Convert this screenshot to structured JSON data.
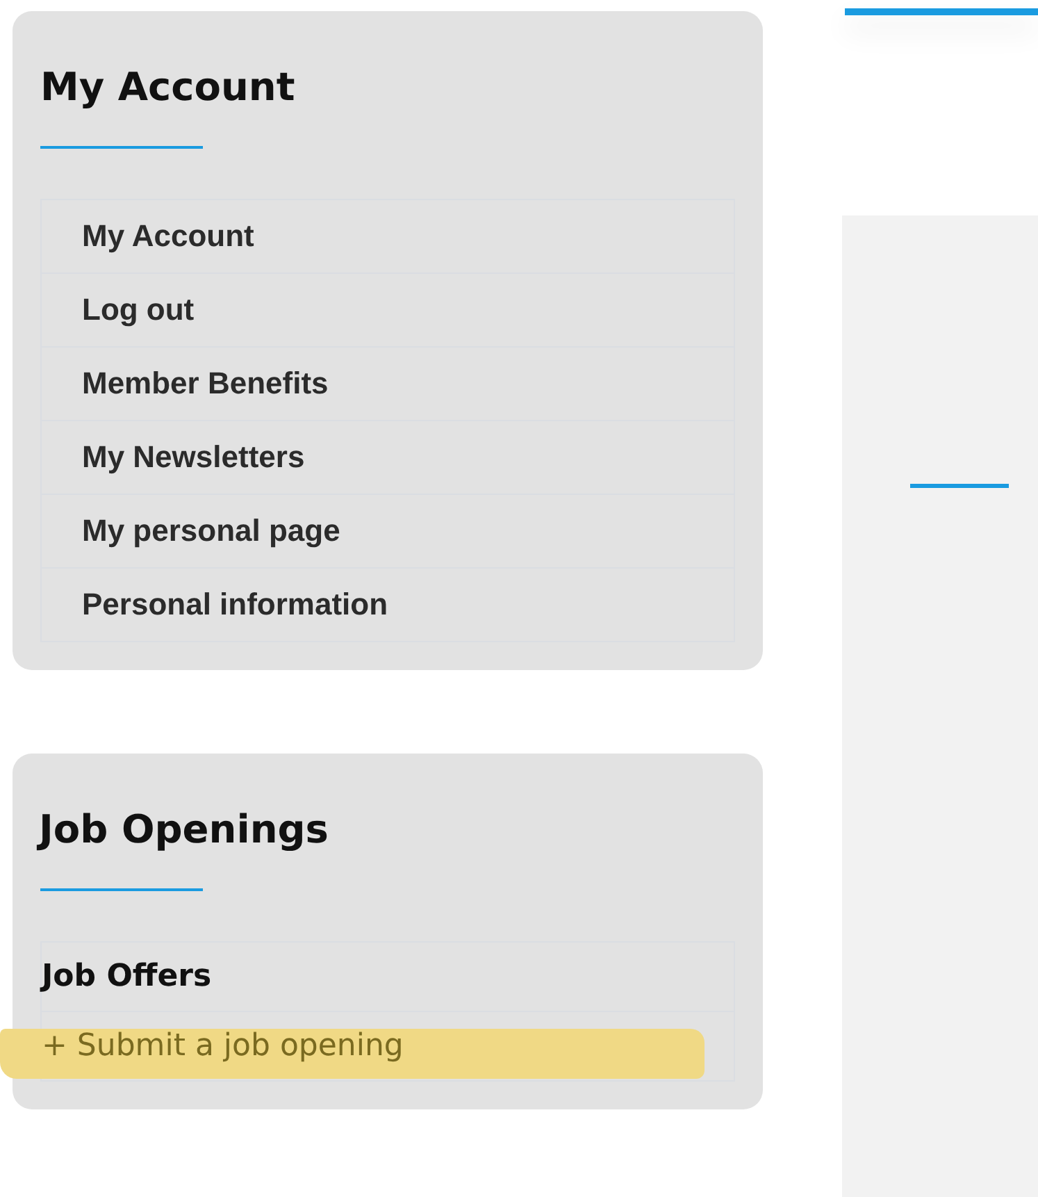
{
  "account_card": {
    "title": "My Account",
    "items": [
      {
        "label": "My Account"
      },
      {
        "label": "Log out"
      },
      {
        "label": "Member Benefits"
      },
      {
        "label": "My Newsletters"
      },
      {
        "label": "My personal page"
      },
      {
        "label": "Personal information"
      }
    ]
  },
  "jobs_card": {
    "title": "Job Openings",
    "items": [
      {
        "label": "Job Offers",
        "highlighted": false
      },
      {
        "label": "+ Submit a job opening",
        "highlighted": true
      }
    ]
  }
}
